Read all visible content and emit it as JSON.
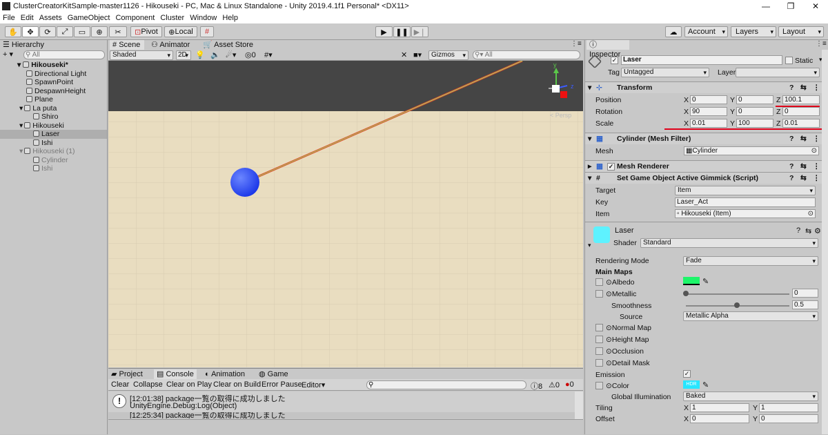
{
  "window": {
    "title": "ClusterCreatorKitSample-master1126 - Hikouseki - PC, Mac & Linux Standalone - Unity 2019.4.1f1 Personal* <DX11>"
  },
  "menu": [
    "File",
    "Edit",
    "Assets",
    "GameObject",
    "Component",
    "Cluster",
    "Window",
    "Help"
  ],
  "toolbar": {
    "pivot": "Pivot",
    "local": "Local",
    "account": "Account",
    "layers": "Layers",
    "layout": "Layout"
  },
  "hierarchy": {
    "tab": "Hierarchy",
    "search": "All",
    "scene": "Hikouseki*",
    "items": [
      {
        "label": "Directional Light",
        "indent": 1,
        "dim": false
      },
      {
        "label": "SpawnPoint",
        "indent": 1,
        "dim": false
      },
      {
        "label": "DespawnHeight",
        "indent": 1,
        "dim": false
      },
      {
        "label": "Plane",
        "indent": 1,
        "dim": false
      },
      {
        "label": "La puta",
        "indent": 1,
        "dim": false,
        "arrow": true
      },
      {
        "label": "Shiro",
        "indent": 2,
        "dim": false
      },
      {
        "label": "Hikouseki",
        "indent": 1,
        "dim": false,
        "arrow": true
      },
      {
        "label": "Laser",
        "indent": 2,
        "dim": false,
        "selected": true
      },
      {
        "label": "Ishi",
        "indent": 2,
        "dim": false
      },
      {
        "label": "Hikouseki (1)",
        "indent": 1,
        "dim": true,
        "arrow": true
      },
      {
        "label": "Cylinder",
        "indent": 2,
        "dim": true
      },
      {
        "label": "Ishi",
        "indent": 2,
        "dim": true
      }
    ]
  },
  "scene": {
    "tab_scene": "Scene",
    "tab_animator": "Animator",
    "tab_store": "Asset Store",
    "shading": "Shaded",
    "mode2d": "2D",
    "hidden_count": "0",
    "gizmos": "Gizmos",
    "search": "All",
    "persp": "< Persp",
    "axis_y": "y",
    "axis_z": "z"
  },
  "console": {
    "tabs": [
      "Project",
      "Console",
      "Animation",
      "Game"
    ],
    "buttons": [
      "Clear",
      "Collapse",
      "Clear on Play",
      "Clear on Build",
      "Error Pause",
      "Editor"
    ],
    "counts": {
      "info": "8",
      "warn": "0",
      "error": "0"
    },
    "log1_line1": "[12:01:38] package一覧の取得に成功しました",
    "log1_line2": "UnityEngine.Debug:Log(Object)",
    "log2_line1": "[12:25:34] package一覧の取得に成功しました"
  },
  "inspector": {
    "tab": "Inspector",
    "name": "Laser",
    "static": "Static",
    "tag_label": "Tag",
    "tag": "Untagged",
    "layer_label": "Layer",
    "layer": "",
    "transform": {
      "title": "Transform",
      "position": {
        "label": "Position",
        "x": "0",
        "y": "0",
        "z": "100.1"
      },
      "rotation": {
        "label": "Rotation",
        "x": "90",
        "y": "0",
        "z": "0"
      },
      "scale": {
        "label": "Scale",
        "x": "0.01",
        "y": "100",
        "z": "0.01"
      }
    },
    "meshfilter": {
      "title": "Cylinder (Mesh Filter)",
      "mesh_label": "Mesh",
      "mesh": "Cylinder"
    },
    "meshrenderer": {
      "title": "Mesh Renderer"
    },
    "script": {
      "title": "Set Game Object Active Gimmick (Script)",
      "target_label": "Target",
      "target": "Item",
      "key_label": "Key",
      "key": "Laser_Act",
      "item_label": "Item",
      "item": "Hikouseki (Item)"
    },
    "material": {
      "name": "Laser",
      "shader_label": "Shader",
      "shader": "Standard",
      "swatch": "#5ef2ff"
    },
    "rendering_mode_label": "Rendering Mode",
    "rendering_mode": "Fade",
    "main_maps": "Main Maps",
    "albedo": "Albedo",
    "albedo_color": "#1ef56a",
    "metallic": "Metallic",
    "metallic_value": "0",
    "smoothness": "Smoothness",
    "smoothness_value": "0.5",
    "source_label": "Source",
    "source": "Metallic Alpha",
    "normal_map": "Normal Map",
    "height_map": "Height Map",
    "occlusion": "Occlusion",
    "detail_mask": "Detail Mask",
    "emission": "Emission",
    "color": "Color",
    "hdr": "HDR",
    "emission_color": "#28e6ff",
    "gi_label": "Global Illumination",
    "gi": "Baked",
    "tiling": {
      "label": "Tiling",
      "x": "1",
      "y": "1"
    },
    "offset": {
      "label": "Offset",
      "x": "0",
      "y": "0"
    }
  },
  "colors": {
    "accent": "#e0001a",
    "sphere": "#2b4dff",
    "ground": "#e9ddc0",
    "sky": "#454545"
  }
}
